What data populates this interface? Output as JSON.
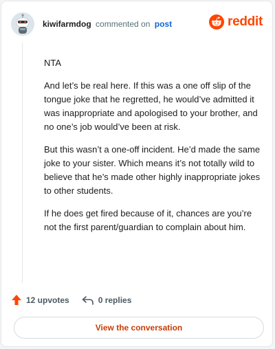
{
  "comment": {
    "username": "kiwifarmdog",
    "action_text": "commented on",
    "post_link": "post",
    "paragraphs": [
      "NTA",
      "And let’s be real here. If this was a one off slip of the tongue joke that he regretted, he would’ve admitted it was inappropriate and apologised to your brother, and no one’s job would’ve been at risk.",
      "But this wasn’t a one-off incident. He’d made the same joke to your sister. Which means it’s not totally wild to believe that he’s made other highly inappropriate jokes to other students.",
      "If he does get fired because of it, chances are you’re not the first parent/guardian to complain about him."
    ],
    "upvotes": "12 upvotes",
    "replies": "0 replies"
  },
  "brand": {
    "name": "reddit",
    "color": "#ff4500"
  },
  "footer": {
    "view_button": "View the conversation"
  },
  "icons": {
    "avatar": "snoo-avatar-icon",
    "logo": "reddit-logo-icon",
    "upvote": "upvote-arrow-icon",
    "reply": "reply-arrow-icon"
  }
}
